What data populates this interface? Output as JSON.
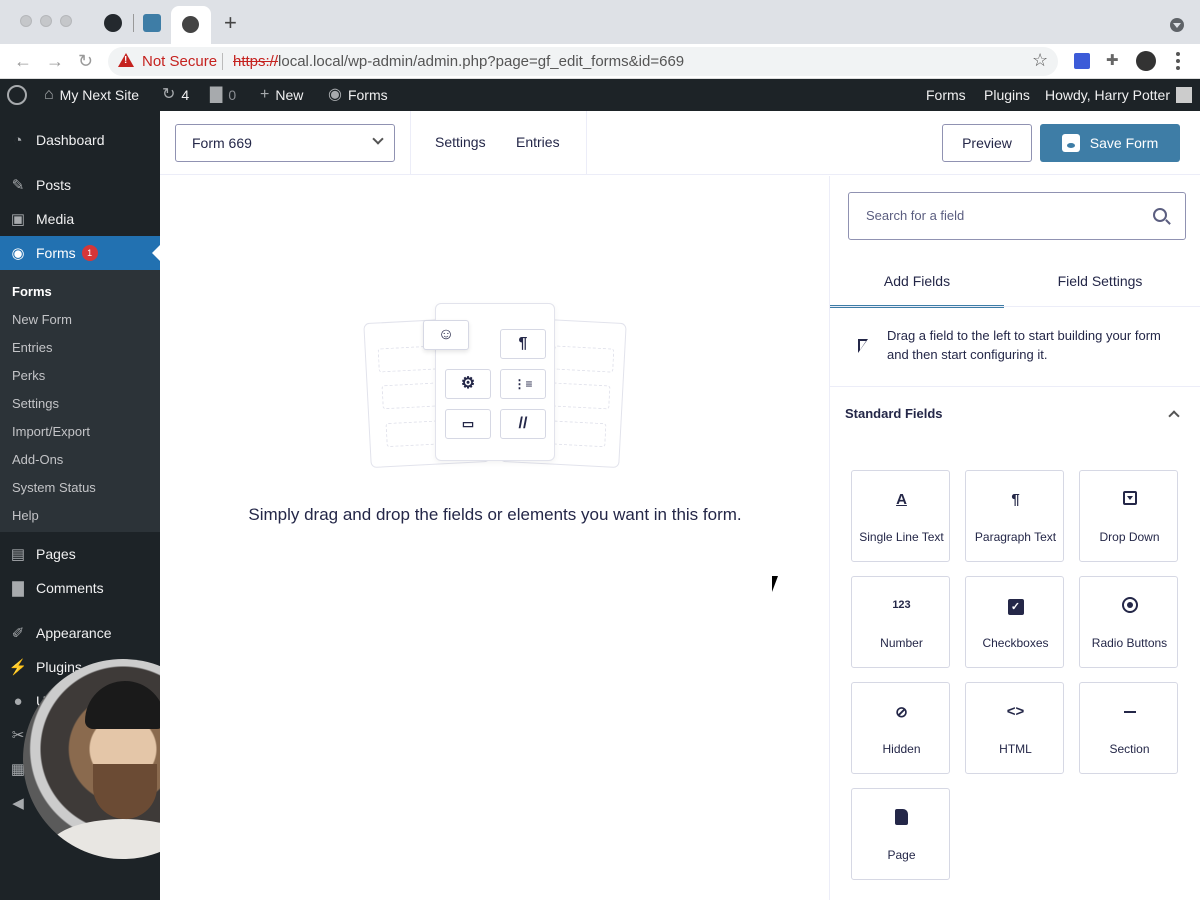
{
  "browser": {
    "url_scheme": "https://",
    "url_rest": "local.local/wp-admin/admin.php?page=gf_edit_forms&id=669",
    "not_secure": "Not Secure"
  },
  "adminbar": {
    "site_name": "My Next Site",
    "updates_count": "4",
    "comments_count": "0",
    "new_label": "New",
    "forms_label": "Forms",
    "right_forms": "Forms",
    "right_plugins": "Plugins",
    "howdy": "Howdy, Harry Potter"
  },
  "sidebar": {
    "dashboard": "Dashboard",
    "posts": "Posts",
    "media": "Media",
    "forms": "Forms",
    "forms_badge": "1",
    "submenu": [
      "Forms",
      "New Form",
      "Entries",
      "Perks",
      "Settings",
      "Import/Export",
      "Add-Ons",
      "System Status",
      "Help"
    ],
    "pages": "Pages",
    "comments": "Comments",
    "appearance": "Appearance",
    "plugins": "Plugins",
    "users_partial": "U"
  },
  "header": {
    "form_select": "Form 669",
    "settings": "Settings",
    "entries": "Entries",
    "preview": "Preview",
    "save": "Save Form"
  },
  "canvas": {
    "empty_message": "Simply drag and drop the fields or elements you want in this form."
  },
  "panel": {
    "search_placeholder": "Search for a field",
    "tab_add": "Add Fields",
    "tab_settings": "Field Settings",
    "hint": "Drag a field to the left to start building your form and then start configuring it.",
    "section_title": "Standard Fields",
    "fields": [
      {
        "label": "Single Line Text",
        "icon": "text-icon"
      },
      {
        "label": "Paragraph Text",
        "icon": "paragraph-icon"
      },
      {
        "label": "Drop Down",
        "icon": "dropdown-icon"
      },
      {
        "label": "Number",
        "icon": "number-icon",
        "glyph": "123"
      },
      {
        "label": "Checkboxes",
        "icon": "checkbox-icon"
      },
      {
        "label": "Radio Buttons",
        "icon": "radio-icon"
      },
      {
        "label": "Hidden",
        "icon": "eye-slash-icon"
      },
      {
        "label": "HTML",
        "icon": "code-icon"
      },
      {
        "label": "Section",
        "icon": "dash-icon"
      },
      {
        "label": "Page",
        "icon": "page-icon"
      }
    ]
  }
}
